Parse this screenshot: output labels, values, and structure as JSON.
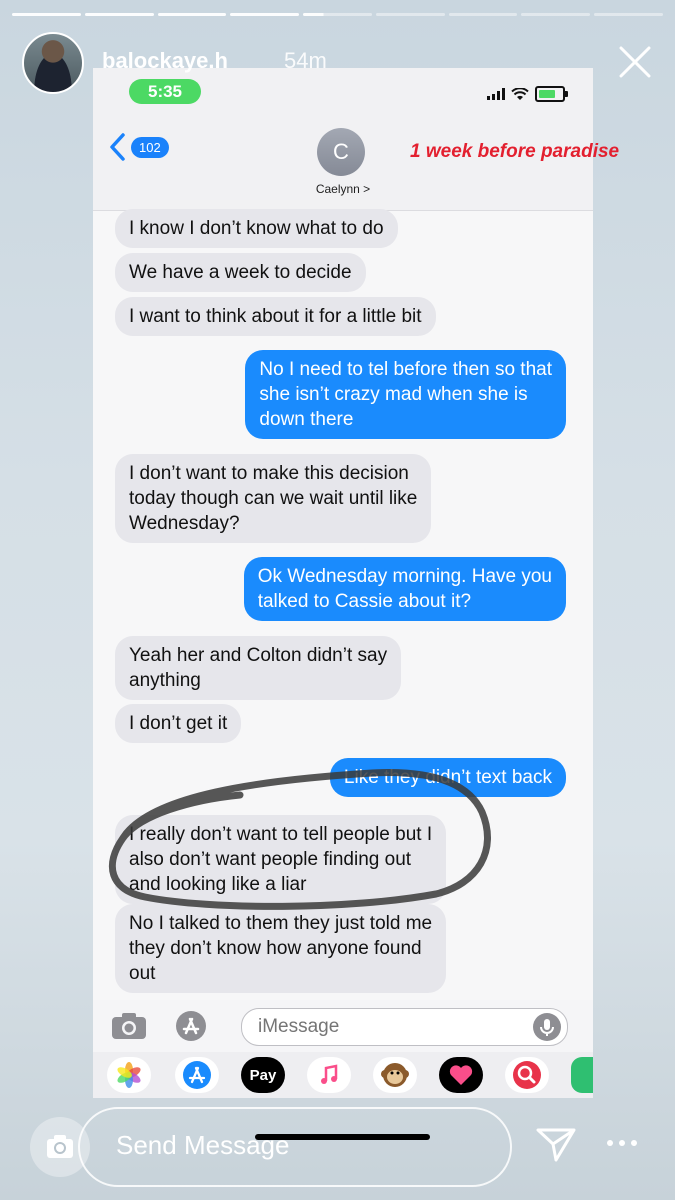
{
  "story": {
    "username": "balockaye.h",
    "time_ago": "54m",
    "progress": {
      "total_segments": 9,
      "completed": 4,
      "current_fraction": 0.3
    }
  },
  "phone": {
    "status_time": "5:35",
    "back_count": "102",
    "contact_initial": "C",
    "contact_name": "Caelynn >",
    "annotation": "1 week before paradise",
    "messages": [
      {
        "dir": "in",
        "text": "I know I don’t know what to do"
      },
      {
        "dir": "in",
        "text": "We have a week to decide"
      },
      {
        "dir": "in",
        "text": "I want to think about it for a little bit"
      },
      {
        "dir": "out",
        "text": "No I need to tel before then so that\nshe isn’t crazy mad when she is\ndown there"
      },
      {
        "dir": "in",
        "text": "I don’t want to make this decision\ntoday though can we wait until like\nWednesday?"
      },
      {
        "dir": "out",
        "text": "Ok Wednesday morning. Have you\ntalked to Cassie about it?"
      },
      {
        "dir": "in",
        "text": "Yeah her and Colton didn’t say\nanything"
      },
      {
        "dir": "in",
        "text": "I don’t get it"
      },
      {
        "dir": "out",
        "text": "Like they didn’t text back"
      },
      {
        "dir": "in",
        "text": "I really don’t want to tell people but I\nalso don’t want people finding out\nand looking like a liar"
      },
      {
        "dir": "in",
        "text": "No I talked to them they just told me\nthey don’t know how anyone found\nout"
      }
    ],
    "composer": {
      "placeholder": "iMessage"
    },
    "apps": [
      "photos-icon",
      "app-store-icon",
      "Pay",
      "music-icon",
      "monkey-icon",
      "heart-icon",
      "search-icon"
    ]
  },
  "footer": {
    "send_label": "Send Message"
  }
}
